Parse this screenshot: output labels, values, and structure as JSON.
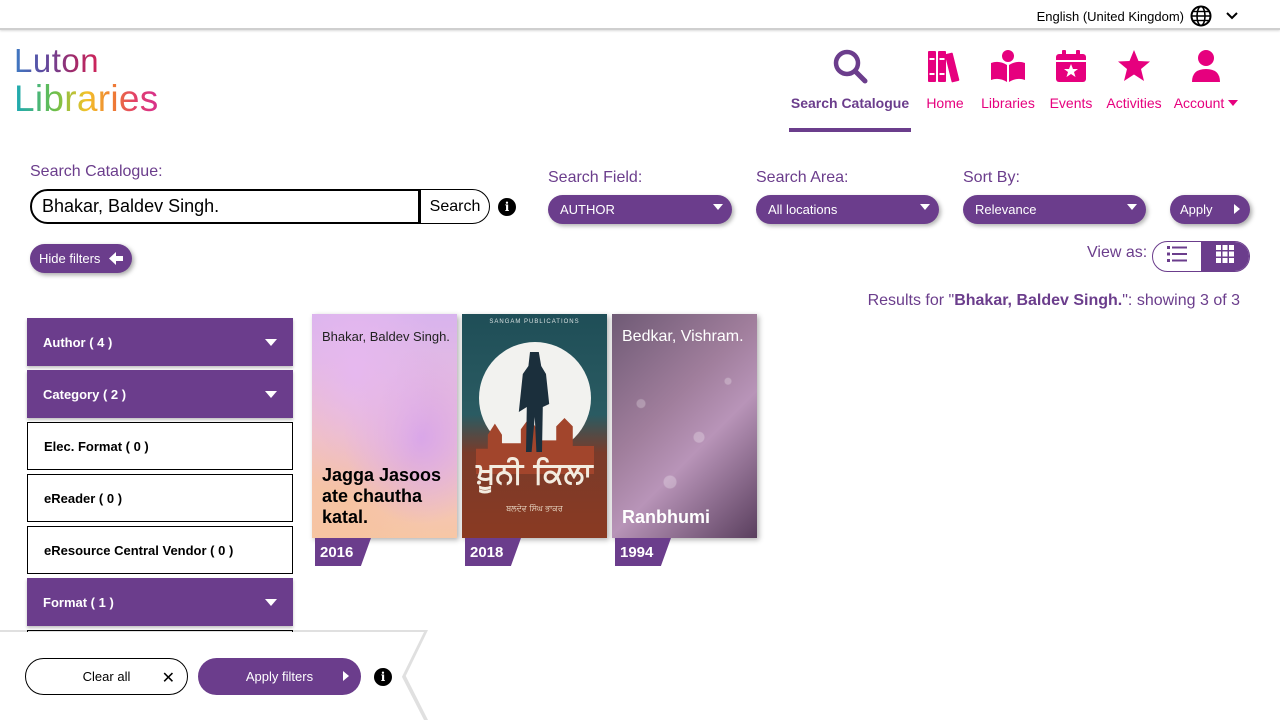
{
  "topbar": {
    "language": "English (United Kingdom)"
  },
  "logo": {
    "line1": "Luton",
    "line2": "Libraries"
  },
  "nav": {
    "items": [
      {
        "label": "Search Catalogue",
        "icon": "search-icon"
      },
      {
        "label": "Home",
        "icon": "books-icon"
      },
      {
        "label": "Libraries",
        "icon": "open-book-icon"
      },
      {
        "label": "Events",
        "icon": "calendar-icon"
      },
      {
        "label": "Activities",
        "icon": "star-icon"
      },
      {
        "label": "Account",
        "icon": "person-icon"
      }
    ]
  },
  "search": {
    "label": "Search Catalogue:",
    "value": "Bhakar, Baldev Singh.",
    "button": "Search",
    "field_label": "Search Field:",
    "field_value": "AUTHOR",
    "area_label": "Search Area:",
    "area_value": "All locations",
    "sort_label": "Sort By:",
    "sort_value": "Relevance",
    "apply": "Apply"
  },
  "controls": {
    "hide_filters": "Hide filters",
    "view_as": "View as:"
  },
  "results": {
    "prefix": "Results for \"",
    "query": "Bhakar, Baldev Singh.",
    "suffix": "\": showing 3 of 3"
  },
  "facets": [
    {
      "label": "Author ( 4 )",
      "style": "dark"
    },
    {
      "label": "Category ( 2 )",
      "style": "dark"
    },
    {
      "label": "Elec. Format ( 0 )",
      "style": "light"
    },
    {
      "label": "eReader ( 0 )",
      "style": "light"
    },
    {
      "label": "eResource Central Vendor ( 0 )",
      "style": "light"
    },
    {
      "label": "Format ( 1 )",
      "style": "dark"
    }
  ],
  "books": [
    {
      "author": "Bhakar, Baldev Singh.",
      "title": "Jagga Jasoos ate chautha katal.",
      "year": "2016"
    },
    {
      "publisher": "SANGAM PUBLICATIONS",
      "cover_title": "ਖ਼ੂਨੀ ਕਿਲਾ",
      "cover_author": "ਬਲਦੇਵ ਸਿੰਘ ਭਾਕਰ",
      "year": "2018"
    },
    {
      "author": "Bedkar, Vishram.",
      "title": "Ranbhumi",
      "year": "1994"
    }
  ],
  "footer": {
    "clear_all": "Clear all",
    "apply_filters": "Apply filters"
  },
  "colors": {
    "brand_purple": "#6b3d8c",
    "accent_pink": "#e6007e"
  }
}
